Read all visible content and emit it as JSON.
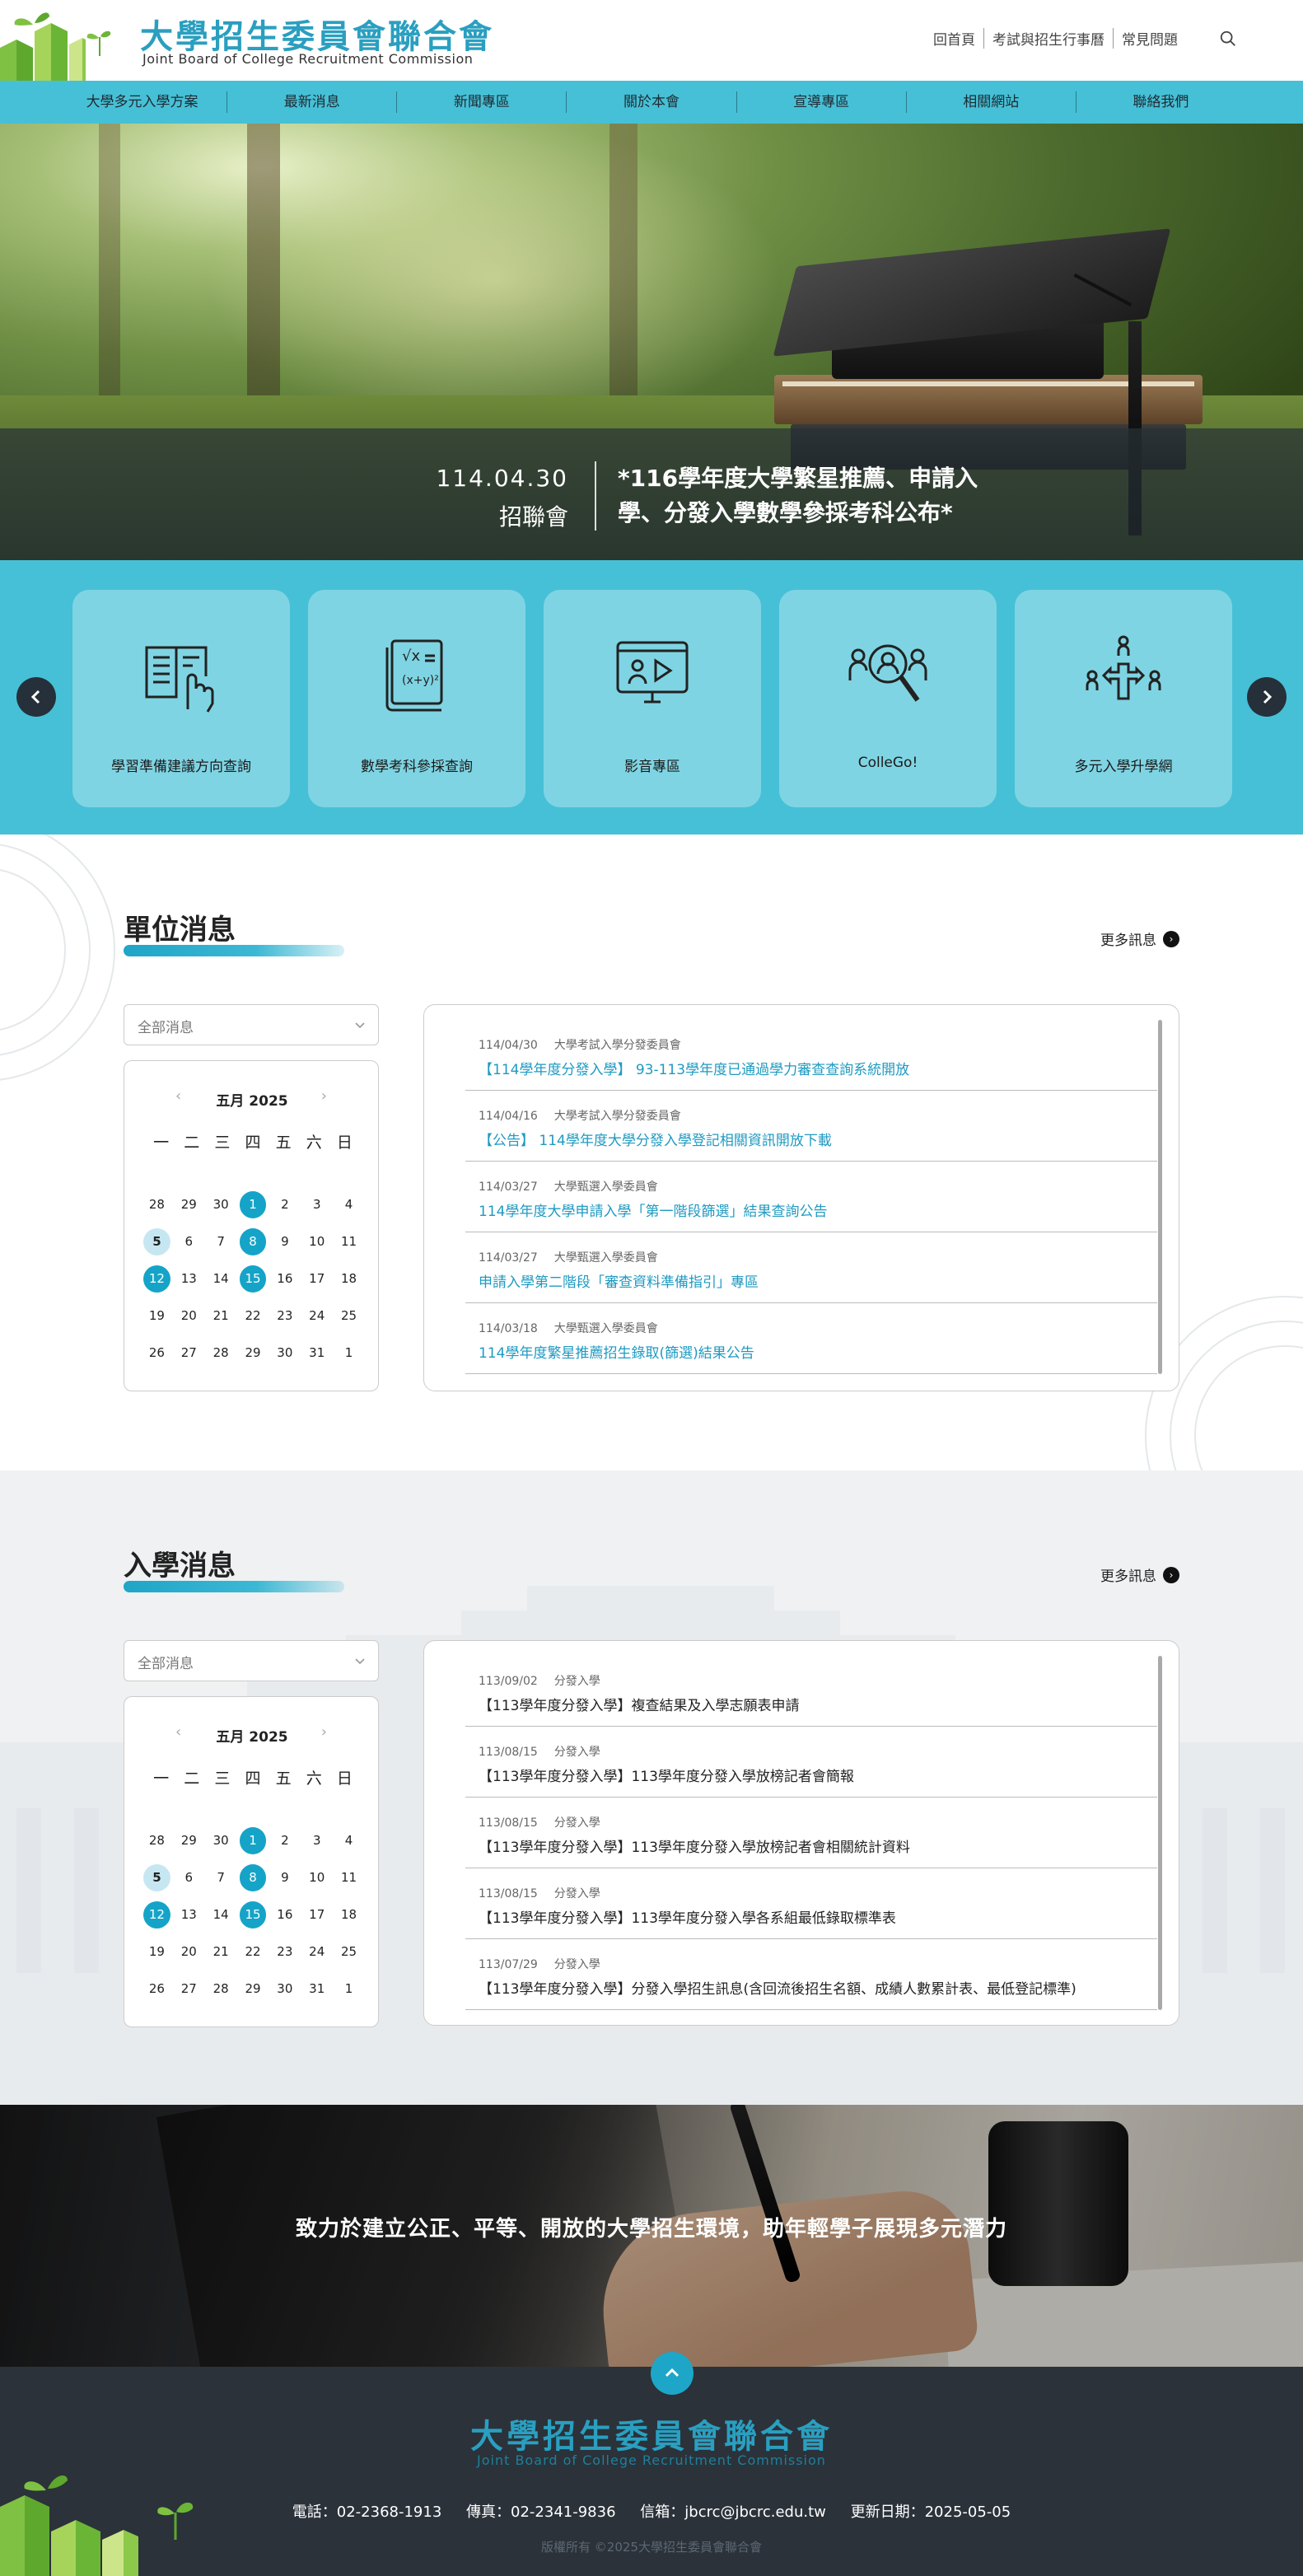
{
  "header": {
    "title": "大學招生委員會聯合會",
    "subtitle": "Joint Board of College Recruitment Commission",
    "top_links": [
      "回首頁",
      "考試與招生行事曆",
      "常見問題"
    ]
  },
  "nav": [
    "大學多元入學方案",
    "最新消息",
    "新聞專區",
    "關於本會",
    "宣導專區",
    "相關網站",
    "聯絡我們"
  ],
  "hero": {
    "date": "114.04.30",
    "source": "招聯會",
    "headline": "*116學年度大學繁星推薦、申請入學、分發入學數學參採考科公布*"
  },
  "quick_links": [
    {
      "label": "學習準備建議方向查詢",
      "icon": "book-hand-icon"
    },
    {
      "label": "數學考科參採查詢",
      "icon": "math-book-icon"
    },
    {
      "label": "影音專區",
      "icon": "video-screen-icon"
    },
    {
      "label": "ColleGo!",
      "icon": "people-search-icon"
    },
    {
      "label": "多元入學升學網",
      "icon": "signpost-people-icon"
    }
  ],
  "colors": {
    "accent": "#46c0d6",
    "brand": "#2a9fc0",
    "highlight": "#15a4c8"
  },
  "unit_news": {
    "title": "單位消息",
    "more": "更多訊息",
    "filter": "全部消息",
    "calendar": {
      "month": "五月 2025",
      "weekdays": [
        "一",
        "二",
        "三",
        "四",
        "五",
        "六",
        "日"
      ],
      "days": [
        "28",
        "29",
        "30",
        "1",
        "2",
        "3",
        "4",
        "5",
        "6",
        "7",
        "8",
        "9",
        "10",
        "11",
        "12",
        "13",
        "14",
        "15",
        "16",
        "17",
        "18",
        "19",
        "20",
        "21",
        "22",
        "23",
        "24",
        "25",
        "26",
        "27",
        "28",
        "29",
        "30",
        "31",
        "1"
      ],
      "highlight_days": [
        "1",
        "8",
        "12",
        "15"
      ],
      "today": "5"
    },
    "items": [
      {
        "date": "114/04/30",
        "dept": "大學考試入學分發委員會",
        "title": "【114學年度分發入學】 93-113學年度已通過學力審查查詢系統開放"
      },
      {
        "date": "114/04/16",
        "dept": "大學考試入學分發委員會",
        "title": "【公告】 114學年度大學分發入學登記相關資訊開放下載"
      },
      {
        "date": "114/03/27",
        "dept": "大學甄選入學委員會",
        "title": "114學年度大學申請入學「第一階段篩選」結果查詢公告"
      },
      {
        "date": "114/03/27",
        "dept": "大學甄選入學委員會",
        "title": "申請入學第二階段「審查資料準備指引」專區"
      },
      {
        "date": "114/03/18",
        "dept": "大學甄選入學委員會",
        "title": "114學年度繁星推薦招生錄取(篩選)結果公告"
      }
    ]
  },
  "admission_news": {
    "title": "入學消息",
    "more": "更多訊息",
    "filter": "全部消息",
    "calendar": {
      "month": "五月 2025",
      "weekdays": [
        "一",
        "二",
        "三",
        "四",
        "五",
        "六",
        "日"
      ],
      "days": [
        "28",
        "29",
        "30",
        "1",
        "2",
        "3",
        "4",
        "5",
        "6",
        "7",
        "8",
        "9",
        "10",
        "11",
        "12",
        "13",
        "14",
        "15",
        "16",
        "17",
        "18",
        "19",
        "20",
        "21",
        "22",
        "23",
        "24",
        "25",
        "26",
        "27",
        "28",
        "29",
        "30",
        "31",
        "1"
      ],
      "highlight_days": [
        "1",
        "8",
        "12",
        "15"
      ],
      "today": "5"
    },
    "items": [
      {
        "date": "113/09/02",
        "dept": "分發入學",
        "title": "【113學年度分發入學】複查結果及入學志願表申請"
      },
      {
        "date": "113/08/15",
        "dept": "分發入學",
        "title": "【113學年度分發入學】113學年度分發入學放榜記者會簡報"
      },
      {
        "date": "113/08/15",
        "dept": "分發入學",
        "title": "【113學年度分發入學】113學年度分發入學放榜記者會相關統計資料"
      },
      {
        "date": "113/08/15",
        "dept": "分發入學",
        "title": "【113學年度分發入學】113學年度分發入學各系組最低錄取標準表"
      },
      {
        "date": "113/07/29",
        "dept": "分發入學",
        "title": "【113學年度分發入學】分發入學招生訊息(含回流後招生名額、成績人數累計表、最低登記標準)"
      }
    ]
  },
  "banner": {
    "text": "致力於建立公正、平等、開放的大學招生環境，助年輕學子展現多元潛力"
  },
  "footer": {
    "title": "大學招生委員會聯合會",
    "subtitle": "Joint Board of College Recruitment Commission",
    "phone": "電話：02-2368-1913",
    "fax": "傳真：02-2341-9836",
    "email": "信箱：jbcrc@jbcrc.edu.tw",
    "updated": "更新日期：2025-05-05",
    "copyright": "版權所有 ©2025大學招生委員會聯合會"
  }
}
